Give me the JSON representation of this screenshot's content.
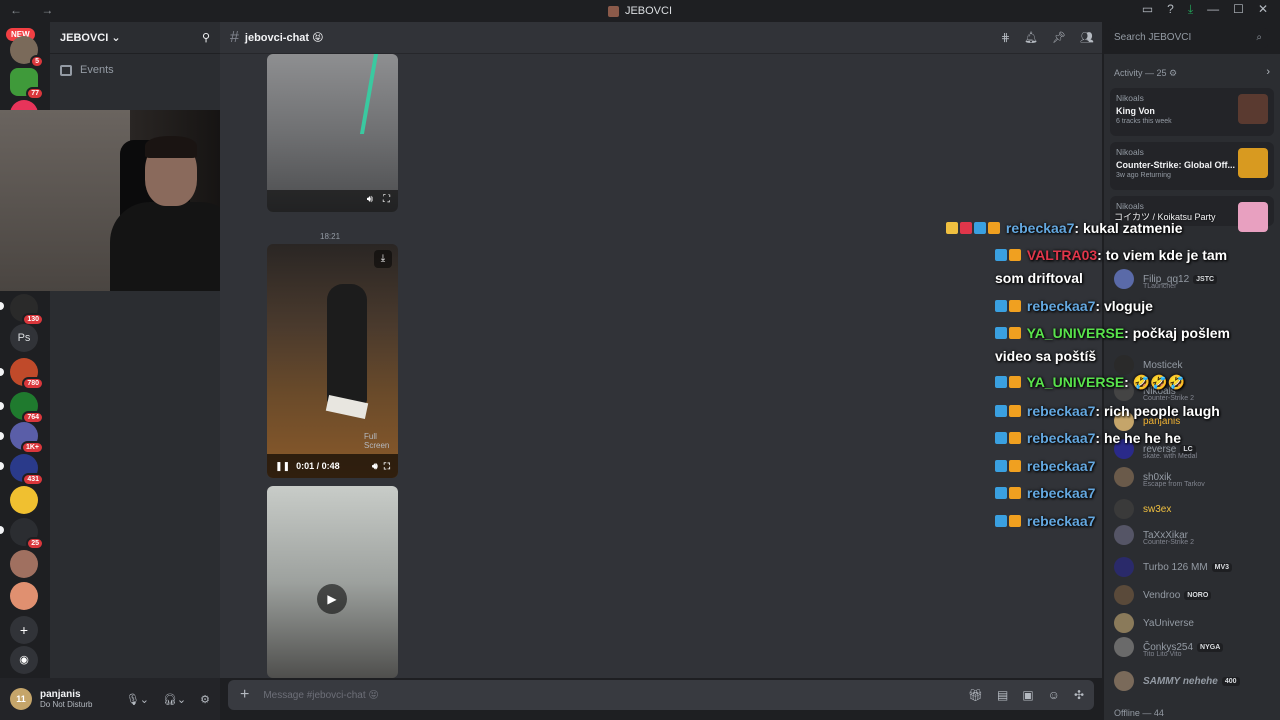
{
  "window": {
    "title": "JEBOVCI"
  },
  "servers": {
    "new_label": "NEW",
    "ps_label": "Ps",
    "badges": [
      "5",
      "77",
      "130",
      "780",
      "764",
      "1K+",
      "431",
      "25"
    ]
  },
  "guild": {
    "name": "JEBOVCI",
    "events_label": "Events"
  },
  "channel": {
    "name": "jebovci-chat 😝"
  },
  "search": {
    "placeholder": "Search JEBOVCI"
  },
  "messages": {
    "timestamp": "18:21",
    "video": {
      "time": "0:01 / 0:48",
      "fullscreen_tooltip": "Full Screen"
    }
  },
  "composer": {
    "placeholder": "Message #jebovci-chat 😝"
  },
  "user": {
    "name": "panjanis",
    "status": "Do Not Disturb"
  },
  "activity": {
    "header": "Activity — 25",
    "cards": [
      {
        "who": "Nikoals",
        "what": "King Von",
        "sub": "6 tracks this week"
      },
      {
        "who": "Nikoals",
        "what": "Counter-Strike: Global Off...",
        "sub": "3w ago   Returning"
      },
      {
        "who": "Nikoals",
        "what": "コイカツ / Koikatsu Party",
        "sub": ""
      }
    ]
  },
  "members": [
    {
      "name": "Filip_qq12",
      "tag": "JSTC",
      "sub": "TLauncher"
    },
    {
      "name": "Mosticek",
      "tag": "",
      "sub": ""
    },
    {
      "name": "Nikoals",
      "tag": "",
      "sub": "Counter-Strike 2"
    },
    {
      "name": "panjanis",
      "tag": "",
      "sub": ""
    },
    {
      "name": "reverse",
      "tag": "LC",
      "sub": "skate. with Medal"
    },
    {
      "name": "sh0xik",
      "tag": "",
      "sub": "Escape from Tarkov"
    },
    {
      "name": "sw3ex",
      "tag": "",
      "sub": ""
    },
    {
      "name": "TaXxXikar",
      "tag": "",
      "sub": "Counter-Strike 2"
    },
    {
      "name": "Turbo 126 MM",
      "tag": "MV3",
      "sub": ""
    },
    {
      "name": "Vendroo",
      "tag": "NORO",
      "sub": ""
    },
    {
      "name": "YaUniverse",
      "tag": "",
      "sub": ""
    },
    {
      "name": "Čonkys254",
      "tag": "NYGA",
      "sub": "Tito Lito Vito"
    },
    {
      "name": "SAMMY nehehe",
      "tag": "400",
      "sub": ""
    }
  ],
  "offline_label": "Offline — 44",
  "overlay": [
    {
      "name": "rebeckaa7",
      "color": "blue",
      "text": ": kukal zatmenie"
    },
    {
      "name": "VALTRA03",
      "color": "red",
      "text": ": to viem kde je tam"
    },
    {
      "name": "",
      "color": "",
      "text": "som driftoval"
    },
    {
      "name": "rebeckaa7",
      "color": "blue",
      "text": ": vloguje"
    },
    {
      "name": "YA_UNIVERSE",
      "color": "green",
      "text": ": počkaj pošlem"
    },
    {
      "name": "",
      "color": "",
      "text": "video sa poštíš"
    },
    {
      "name": "YA_UNIVERSE",
      "color": "green",
      "text": ": 🤣🤣🤣"
    },
    {
      "name": "rebeckaa7",
      "color": "blue",
      "text": ": rich people laugh"
    },
    {
      "name": "rebeckaa7",
      "color": "blue",
      "text": ": he he he he"
    },
    {
      "name": "rebeckaa7",
      "color": "blue",
      "text": ""
    },
    {
      "name": "rebeckaa7",
      "color": "blue",
      "text": ""
    },
    {
      "name": "rebeckaa7",
      "color": "blue",
      "text": ""
    }
  ]
}
